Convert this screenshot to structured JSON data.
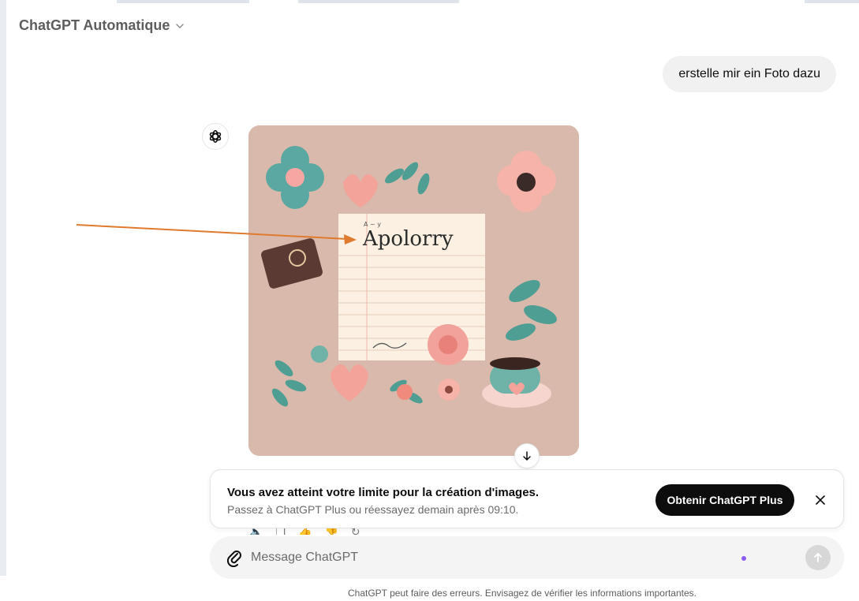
{
  "header": {
    "model_label": "ChatGPT Automatique"
  },
  "conversation": {
    "user_message": "erstelle mir ein Foto dazu",
    "image_card_text": "Apolorry",
    "image_card_subtext": "A ~ y"
  },
  "limit_banner": {
    "title": "Vous avez atteint votre limite pour la création d'images.",
    "subtitle": "Passez à ChatGPT Plus ou réessayez demain après 09:10.",
    "cta_label": "Obtenir ChatGPT Plus"
  },
  "composer": {
    "placeholder": "Message ChatGPT"
  },
  "footer": {
    "disclaimer": "ChatGPT peut faire des erreurs. Envisagez de vérifier les informations importantes."
  },
  "colors": {
    "annotation_arrow": "#e07a2e",
    "image_background": "#d8b9ab",
    "cta_background": "#0d0d0d",
    "voice_dot": "#8b5cf6"
  },
  "icons": {
    "model_chevron": "chevron-down-icon",
    "assistant": "openai-logo-icon",
    "download": "arrow-down-icon",
    "close": "close-icon",
    "attach": "paperclip-icon",
    "send": "arrow-up-icon"
  }
}
